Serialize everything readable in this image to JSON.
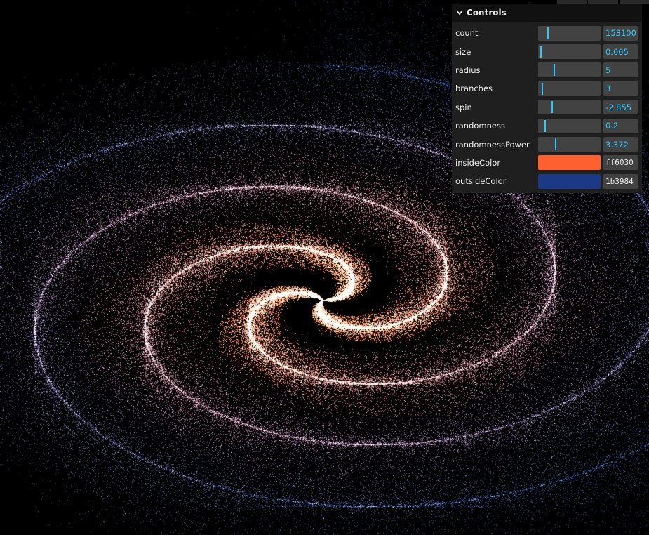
{
  "panel": {
    "title": "Controls",
    "controls": [
      {
        "label": "count",
        "value": "153100",
        "fraction": 0.15
      },
      {
        "label": "size",
        "value": "0.005",
        "fraction": 0.03
      },
      {
        "label": "radius",
        "value": "5",
        "fraction": 0.25
      },
      {
        "label": "branches",
        "value": "3",
        "fraction": 0.06
      },
      {
        "label": "spin",
        "value": "-2.855",
        "fraction": 0.21
      },
      {
        "label": "randomness",
        "value": "0.2",
        "fraction": 0.1
      },
      {
        "label": "randomnessPower",
        "value": "3.372",
        "fraction": 0.27
      }
    ],
    "colors": [
      {
        "label": "insideColor",
        "hex": "ff6030",
        "swatch": "#ff6030"
      },
      {
        "label": "outsideColor",
        "hex": "1b3984",
        "swatch": "#1b3984"
      }
    ]
  },
  "theme": {
    "accent": "#2cc9ff",
    "background": "#000000"
  }
}
